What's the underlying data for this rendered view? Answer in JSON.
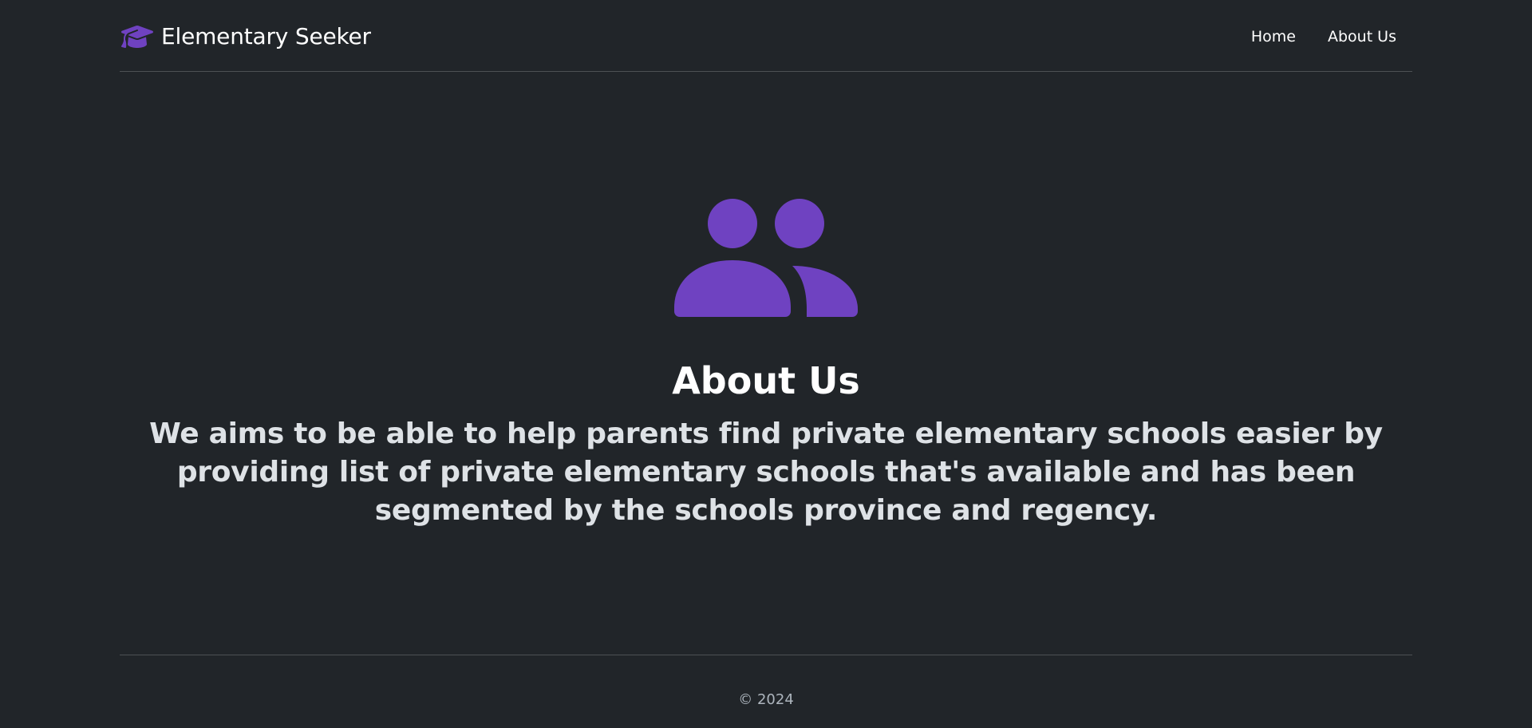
{
  "header": {
    "brand": {
      "icon": "graduation-cap-icon",
      "name": "Elementary Seeker"
    },
    "nav": [
      {
        "label": "Home"
      },
      {
        "label": "About Us"
      }
    ]
  },
  "main": {
    "icon": "people-icon",
    "title": "About Us",
    "description": "We aims to be able to help parents find private elementary schools easier by providing list of private elementary schools that's available and has been segmented by the schools province and regency."
  },
  "footer": {
    "copyright": "© 2024"
  },
  "colors": {
    "background": "#212529",
    "accent": "#6f42c1",
    "text": "#ffffff",
    "muted_text": "#adb5bd",
    "divider": "#4d5154"
  }
}
